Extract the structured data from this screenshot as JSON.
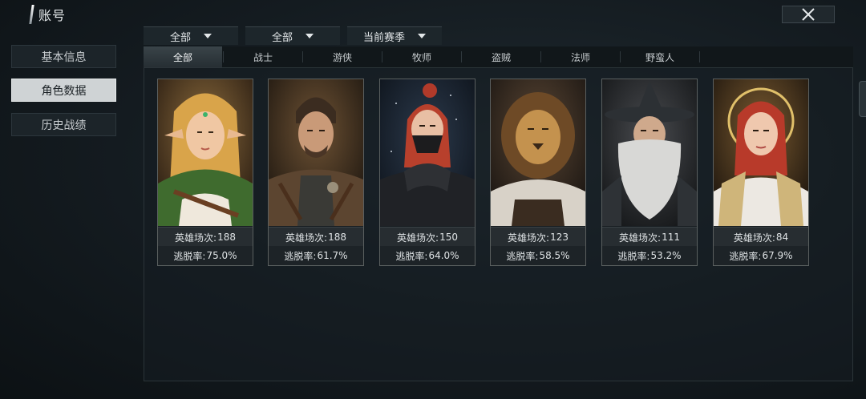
{
  "header": {
    "title": "账号",
    "close_icon": "close-icon"
  },
  "sidebar": {
    "items": [
      {
        "label": "基本信息",
        "active": false
      },
      {
        "label": "角色数据",
        "active": true
      },
      {
        "label": "历史战绩",
        "active": false
      }
    ]
  },
  "filters": [
    {
      "value": "全部"
    },
    {
      "value": "全部"
    },
    {
      "value": "当前赛季"
    }
  ],
  "tabs": [
    {
      "label": "全部",
      "active": true
    },
    {
      "label": "战士"
    },
    {
      "label": "游侠"
    },
    {
      "label": "牧师"
    },
    {
      "label": "盗贼"
    },
    {
      "label": "法师"
    },
    {
      "label": "野蛮人"
    }
  ],
  "characters": [
    {
      "games_label": "英雄场次:",
      "games": "188",
      "escape_label": "逃脱率:",
      "escape": "75.0%",
      "portrait": "elf-ranger-portrait"
    },
    {
      "games_label": "英雄场次:",
      "games": "188",
      "escape_label": "逃脱率:",
      "escape": "61.7%",
      "portrait": "warrior-portrait"
    },
    {
      "games_label": "英雄场次:",
      "games": "150",
      "escape_label": "逃脱率:",
      "escape": "64.0%",
      "portrait": "masked-rogue-portrait"
    },
    {
      "games_label": "英雄场次:",
      "games": "123",
      "escape_label": "逃脱率:",
      "escape": "58.5%",
      "portrait": "lion-barbarian-portrait"
    },
    {
      "games_label": "英雄场次:",
      "games": "111",
      "escape_label": "逃脱率:",
      "escape": "53.2%",
      "portrait": "wizard-portrait"
    },
    {
      "games_label": "英雄场次:",
      "games": "84",
      "escape_label": "逃脱率:",
      "escape": "67.9%",
      "portrait": "cleric-portrait"
    }
  ],
  "colors": {
    "active_tab": "#3a4449",
    "card_border": "#5a5f5f",
    "active_sidebar": "#cfd3d5"
  }
}
